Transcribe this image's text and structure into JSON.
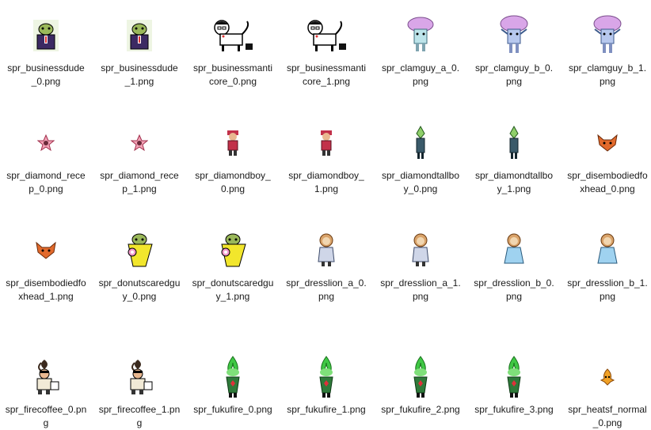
{
  "files": [
    {
      "name": "spr_businessdude_0.png",
      "icon": "business-dude-icon"
    },
    {
      "name": "spr_businessdude_1.png",
      "icon": "business-dude-icon"
    },
    {
      "name": "spr_businessmanticore_0.png",
      "icon": "business-manticore-icon"
    },
    {
      "name": "spr_businessmanticore_1.png",
      "icon": "business-manticore-icon"
    },
    {
      "name": "spr_clamguy_a_0.png",
      "icon": "clamguy-icon"
    },
    {
      "name": "spr_clamguy_b_0.png",
      "icon": "clamguy-icon"
    },
    {
      "name": "spr_clamguy_b_1.png",
      "icon": "clamguy-icon"
    },
    {
      "name": "spr_diamond_recep_0.png",
      "icon": "diamond-recep-icon"
    },
    {
      "name": "spr_diamond_recep_1.png",
      "icon": "diamond-recep-icon"
    },
    {
      "name": "spr_diamondboy_0.png",
      "icon": "diamondboy-icon"
    },
    {
      "name": "spr_diamondboy_1.png",
      "icon": "diamondboy-icon"
    },
    {
      "name": "spr_diamondtallboy_0.png",
      "icon": "diamond-tallboy-icon"
    },
    {
      "name": "spr_diamondtallboy_1.png",
      "icon": "diamond-tallboy-icon"
    },
    {
      "name": "spr_disembodiedfoxhead_0.png",
      "icon": "fox-head-icon"
    },
    {
      "name": "spr_disembodiedfoxhead_1.png",
      "icon": "fox-head-icon"
    },
    {
      "name": "spr_donutscaredguy_0.png",
      "icon": "donut-scared-guy-icon"
    },
    {
      "name": "spr_donutscaredguy_1.png",
      "icon": "donut-scared-guy-icon"
    },
    {
      "name": "spr_dresslion_a_0.png",
      "icon": "dress-lion-icon"
    },
    {
      "name": "spr_dresslion_a_1.png",
      "icon": "dress-lion-icon"
    },
    {
      "name": "spr_dresslion_b_0.png",
      "icon": "dress-lion-blue-icon"
    },
    {
      "name": "spr_dresslion_b_1.png",
      "icon": "dress-lion-blue-icon"
    },
    {
      "name": "spr_firecoffee_0.png",
      "icon": "fire-coffee-icon"
    },
    {
      "name": "spr_firecoffee_1.png",
      "icon": "fire-coffee-icon"
    },
    {
      "name": "spr_fukufire_0.png",
      "icon": "fukufire-icon"
    },
    {
      "name": "spr_fukufire_1.png",
      "icon": "fukufire-icon"
    },
    {
      "name": "spr_fukufire_2.png",
      "icon": "fukufire-icon"
    },
    {
      "name": "spr_fukufire_3.png",
      "icon": "fukufire-icon"
    },
    {
      "name": "spr_heatsf_normal_0.png",
      "icon": "heatsf-icon"
    }
  ]
}
